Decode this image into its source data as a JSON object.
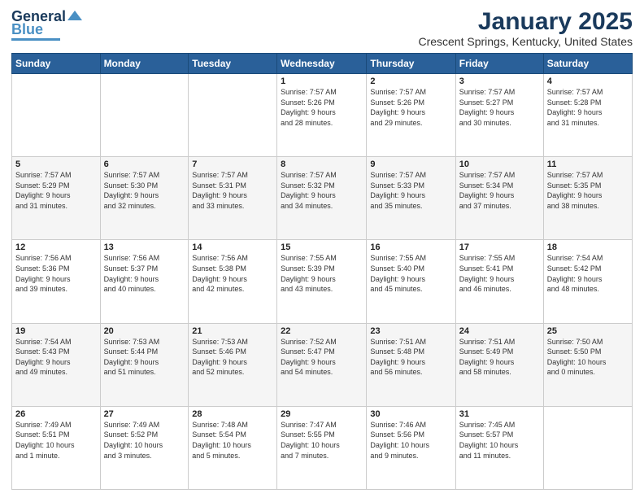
{
  "header": {
    "logo_general": "General",
    "logo_blue": "Blue",
    "title": "January 2025",
    "subtitle": "Crescent Springs, Kentucky, United States"
  },
  "calendar": {
    "days_of_week": [
      "Sunday",
      "Monday",
      "Tuesday",
      "Wednesday",
      "Thursday",
      "Friday",
      "Saturday"
    ],
    "weeks": [
      [
        {
          "day": "",
          "info": ""
        },
        {
          "day": "",
          "info": ""
        },
        {
          "day": "",
          "info": ""
        },
        {
          "day": "1",
          "info": "Sunrise: 7:57 AM\nSunset: 5:26 PM\nDaylight: 9 hours\nand 28 minutes."
        },
        {
          "day": "2",
          "info": "Sunrise: 7:57 AM\nSunset: 5:26 PM\nDaylight: 9 hours\nand 29 minutes."
        },
        {
          "day": "3",
          "info": "Sunrise: 7:57 AM\nSunset: 5:27 PM\nDaylight: 9 hours\nand 30 minutes."
        },
        {
          "day": "4",
          "info": "Sunrise: 7:57 AM\nSunset: 5:28 PM\nDaylight: 9 hours\nand 31 minutes."
        }
      ],
      [
        {
          "day": "5",
          "info": "Sunrise: 7:57 AM\nSunset: 5:29 PM\nDaylight: 9 hours\nand 31 minutes."
        },
        {
          "day": "6",
          "info": "Sunrise: 7:57 AM\nSunset: 5:30 PM\nDaylight: 9 hours\nand 32 minutes."
        },
        {
          "day": "7",
          "info": "Sunrise: 7:57 AM\nSunset: 5:31 PM\nDaylight: 9 hours\nand 33 minutes."
        },
        {
          "day": "8",
          "info": "Sunrise: 7:57 AM\nSunset: 5:32 PM\nDaylight: 9 hours\nand 34 minutes."
        },
        {
          "day": "9",
          "info": "Sunrise: 7:57 AM\nSunset: 5:33 PM\nDaylight: 9 hours\nand 35 minutes."
        },
        {
          "day": "10",
          "info": "Sunrise: 7:57 AM\nSunset: 5:34 PM\nDaylight: 9 hours\nand 37 minutes."
        },
        {
          "day": "11",
          "info": "Sunrise: 7:57 AM\nSunset: 5:35 PM\nDaylight: 9 hours\nand 38 minutes."
        }
      ],
      [
        {
          "day": "12",
          "info": "Sunrise: 7:56 AM\nSunset: 5:36 PM\nDaylight: 9 hours\nand 39 minutes."
        },
        {
          "day": "13",
          "info": "Sunrise: 7:56 AM\nSunset: 5:37 PM\nDaylight: 9 hours\nand 40 minutes."
        },
        {
          "day": "14",
          "info": "Sunrise: 7:56 AM\nSunset: 5:38 PM\nDaylight: 9 hours\nand 42 minutes."
        },
        {
          "day": "15",
          "info": "Sunrise: 7:55 AM\nSunset: 5:39 PM\nDaylight: 9 hours\nand 43 minutes."
        },
        {
          "day": "16",
          "info": "Sunrise: 7:55 AM\nSunset: 5:40 PM\nDaylight: 9 hours\nand 45 minutes."
        },
        {
          "day": "17",
          "info": "Sunrise: 7:55 AM\nSunset: 5:41 PM\nDaylight: 9 hours\nand 46 minutes."
        },
        {
          "day": "18",
          "info": "Sunrise: 7:54 AM\nSunset: 5:42 PM\nDaylight: 9 hours\nand 48 minutes."
        }
      ],
      [
        {
          "day": "19",
          "info": "Sunrise: 7:54 AM\nSunset: 5:43 PM\nDaylight: 9 hours\nand 49 minutes."
        },
        {
          "day": "20",
          "info": "Sunrise: 7:53 AM\nSunset: 5:44 PM\nDaylight: 9 hours\nand 51 minutes."
        },
        {
          "day": "21",
          "info": "Sunrise: 7:53 AM\nSunset: 5:46 PM\nDaylight: 9 hours\nand 52 minutes."
        },
        {
          "day": "22",
          "info": "Sunrise: 7:52 AM\nSunset: 5:47 PM\nDaylight: 9 hours\nand 54 minutes."
        },
        {
          "day": "23",
          "info": "Sunrise: 7:51 AM\nSunset: 5:48 PM\nDaylight: 9 hours\nand 56 minutes."
        },
        {
          "day": "24",
          "info": "Sunrise: 7:51 AM\nSunset: 5:49 PM\nDaylight: 9 hours\nand 58 minutes."
        },
        {
          "day": "25",
          "info": "Sunrise: 7:50 AM\nSunset: 5:50 PM\nDaylight: 10 hours\nand 0 minutes."
        }
      ],
      [
        {
          "day": "26",
          "info": "Sunrise: 7:49 AM\nSunset: 5:51 PM\nDaylight: 10 hours\nand 1 minute."
        },
        {
          "day": "27",
          "info": "Sunrise: 7:49 AM\nSunset: 5:52 PM\nDaylight: 10 hours\nand 3 minutes."
        },
        {
          "day": "28",
          "info": "Sunrise: 7:48 AM\nSunset: 5:54 PM\nDaylight: 10 hours\nand 5 minutes."
        },
        {
          "day": "29",
          "info": "Sunrise: 7:47 AM\nSunset: 5:55 PM\nDaylight: 10 hours\nand 7 minutes."
        },
        {
          "day": "30",
          "info": "Sunrise: 7:46 AM\nSunset: 5:56 PM\nDaylight: 10 hours\nand 9 minutes."
        },
        {
          "day": "31",
          "info": "Sunrise: 7:45 AM\nSunset: 5:57 PM\nDaylight: 10 hours\nand 11 minutes."
        },
        {
          "day": "",
          "info": ""
        }
      ]
    ]
  }
}
